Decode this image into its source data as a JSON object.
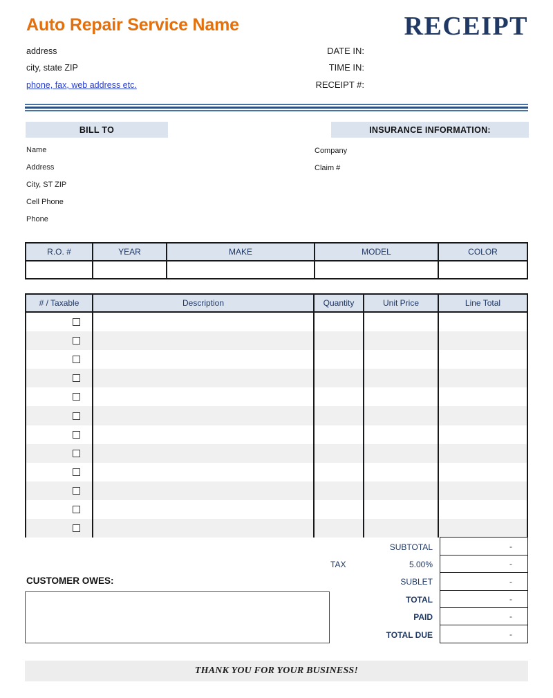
{
  "header": {
    "company_name": "Auto Repair Service Name",
    "address_line1": "address",
    "address_line2": "city, state ZIP",
    "contact_link": "phone, fax, web address etc.",
    "doc_title": "RECEIPT",
    "meta": [
      {
        "label": "DATE IN:",
        "value": ""
      },
      {
        "label": "TIME IN:",
        "value": ""
      },
      {
        "label": "RECEIPT #:",
        "value": ""
      }
    ],
    "brand_color": "#e2700d",
    "title_color": "#1f3864",
    "link_color": "#2b3fd0"
  },
  "bill_to": {
    "heading": "BILL TO",
    "fields": [
      {
        "label": "Name",
        "value": ""
      },
      {
        "label": "Address",
        "value": ""
      },
      {
        "label": "City, ST ZIP",
        "value": ""
      },
      {
        "label": "Cell Phone",
        "value": ""
      },
      {
        "label": "Phone",
        "value": ""
      }
    ]
  },
  "insurance": {
    "heading": "INSURANCE INFORMATION:",
    "fields": [
      {
        "label": "Company",
        "value": ""
      },
      {
        "label": "Claim #",
        "value": ""
      }
    ]
  },
  "vehicle_table": {
    "columns": [
      "R.O. #",
      "YEAR",
      "MAKE",
      "MODEL",
      "COLOR"
    ],
    "rows": [
      {
        "ro": "",
        "year": "",
        "make": "",
        "model": "",
        "color": ""
      }
    ]
  },
  "items_table": {
    "columns": [
      "# / Taxable",
      "Description",
      "Quantity",
      "Unit Price",
      "Line Total"
    ],
    "row_count": 12,
    "rows": [
      {
        "taxable": false,
        "description": "",
        "quantity": "",
        "unit_price": "",
        "line_total": ""
      },
      {
        "taxable": false,
        "description": "",
        "quantity": "",
        "unit_price": "",
        "line_total": ""
      },
      {
        "taxable": false,
        "description": "",
        "quantity": "",
        "unit_price": "",
        "line_total": ""
      },
      {
        "taxable": false,
        "description": "",
        "quantity": "",
        "unit_price": "",
        "line_total": ""
      },
      {
        "taxable": false,
        "description": "",
        "quantity": "",
        "unit_price": "",
        "line_total": ""
      },
      {
        "taxable": false,
        "description": "",
        "quantity": "",
        "unit_price": "",
        "line_total": ""
      },
      {
        "taxable": false,
        "description": "",
        "quantity": "",
        "unit_price": "",
        "line_total": ""
      },
      {
        "taxable": false,
        "description": "",
        "quantity": "",
        "unit_price": "",
        "line_total": ""
      },
      {
        "taxable": false,
        "description": "",
        "quantity": "",
        "unit_price": "",
        "line_total": ""
      },
      {
        "taxable": false,
        "description": "",
        "quantity": "",
        "unit_price": "",
        "line_total": ""
      },
      {
        "taxable": false,
        "description": "",
        "quantity": "",
        "unit_price": "",
        "line_total": ""
      },
      {
        "taxable": false,
        "description": "",
        "quantity": "",
        "unit_price": "",
        "line_total": ""
      }
    ]
  },
  "totals": {
    "tax_prefix": "TAX",
    "rows": [
      {
        "label": "SUBTOTAL",
        "value": "-",
        "bold": false
      },
      {
        "label": "5.00%",
        "value": "-",
        "bold": false
      },
      {
        "label": "SUBLET",
        "value": "-",
        "bold": false
      },
      {
        "label": "TOTAL",
        "value": "-",
        "bold": true
      },
      {
        "label": "PAID",
        "value": "-",
        "bold": true
      },
      {
        "label": "TOTAL DUE",
        "value": "-",
        "bold": true
      }
    ]
  },
  "customer_owes": {
    "label": "CUSTOMER OWES:",
    "value": ""
  },
  "footer": {
    "message": "THANK YOU FOR YOUR BUSINESS!"
  }
}
